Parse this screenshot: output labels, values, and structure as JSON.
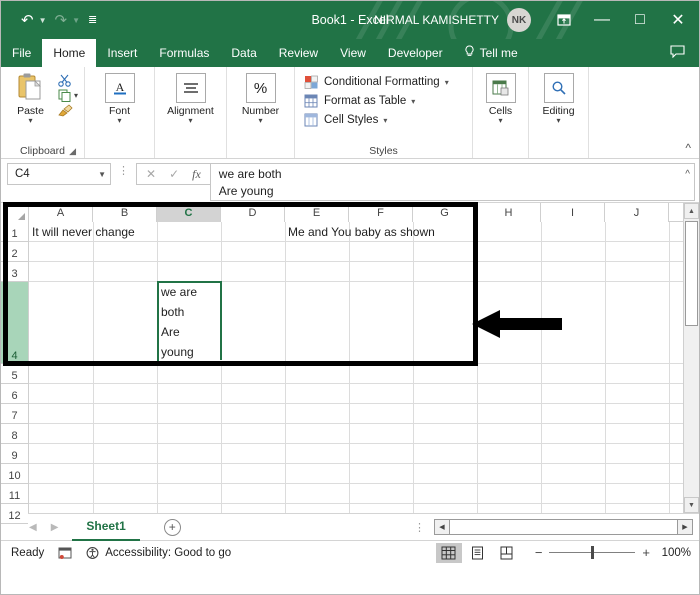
{
  "titlebar": {
    "doc_title": "Book1  -  Excel",
    "user_name": "NIRMAL KAMISHETTY",
    "avatar_initials": "NK",
    "qat": [
      {
        "name": "undo",
        "glyph": "↶"
      },
      {
        "name": "redo",
        "glyph": "↷"
      },
      {
        "name": "customize-quick-access-toolbar",
        "glyph": "☰"
      }
    ],
    "window_buttons": {
      "ribbon_display_options": "⊞",
      "minimize": "—",
      "maximize": "□",
      "close": "✕"
    }
  },
  "tabs": {
    "items": [
      {
        "label": "File",
        "active": false
      },
      {
        "label": "Home",
        "active": true
      },
      {
        "label": "Insert",
        "active": false
      },
      {
        "label": "Formulas",
        "active": false
      },
      {
        "label": "Data",
        "active": false
      },
      {
        "label": "Review",
        "active": false
      },
      {
        "label": "View",
        "active": false
      },
      {
        "label": "Developer",
        "active": false
      }
    ],
    "tell_me": "Tell me",
    "tell_me_icon": "💡",
    "share_icon": "💬"
  },
  "ribbon": {
    "groups": [
      {
        "name": "clipboard",
        "label": "Clipboard",
        "paste_label": "Paste",
        "small_items": [
          {
            "name": "cut",
            "glyph": "✂"
          },
          {
            "name": "copy",
            "glyph": "⧉"
          },
          {
            "name": "format-painter",
            "glyph": "🖌"
          }
        ]
      },
      {
        "name": "font",
        "label": "",
        "button_label": "Font",
        "button_glyph": "A"
      },
      {
        "name": "alignment",
        "label": "",
        "button_label": "Alignment",
        "button_glyph": "≡"
      },
      {
        "name": "number",
        "label": "",
        "button_label": "Number",
        "button_glyph": "%"
      },
      {
        "name": "styles",
        "label": "Styles",
        "rows": [
          {
            "label": "Conditional Formatting",
            "caret": true
          },
          {
            "label": "Format as Table",
            "caret": true
          },
          {
            "label": "Cell Styles",
            "caret": true
          }
        ]
      },
      {
        "name": "cells",
        "label": "",
        "button_label": "Cells",
        "button_glyph": "⊞"
      },
      {
        "name": "editing",
        "label": "",
        "button_label": "Editing",
        "button_glyph": "🔍"
      }
    ],
    "collapse_glyph": "⌃"
  },
  "formula_bar": {
    "name_box_value": "C4",
    "name_box_caret": "▾",
    "cancel_icon": "✕",
    "enter_icon": "✓",
    "function_icon": "fx",
    "content_lines": [
      "we are both",
      "Are young"
    ],
    "expand_icon": "⌃"
  },
  "grid": {
    "columns": [
      "A",
      "B",
      "C",
      "D",
      "E",
      "F",
      "G",
      "H",
      "I",
      "J"
    ],
    "selected_column": "C",
    "rows": [
      "1",
      "2",
      "3",
      "4",
      "5",
      "6",
      "7",
      "8",
      "9",
      "10",
      "11",
      "12"
    ],
    "selected_row": "4",
    "cells": [
      {
        "ref": "A1",
        "value": "It will never change"
      },
      {
        "ref": "E1",
        "value": "Me and You baby as shown"
      }
    ],
    "active_cell": {
      "ref": "C4",
      "wrapped_lines": [
        "we are",
        "both",
        "Are",
        "young"
      ]
    },
    "annotations": [
      {
        "name": "highlight-box",
        "shape": "rectangle",
        "color": "#000000"
      },
      {
        "name": "pointer-arrow",
        "shape": "left-arrow",
        "color": "#000000"
      }
    ]
  },
  "sheet_bar": {
    "nav_prev": "◀",
    "nav_next": "▶",
    "sheets": [
      {
        "label": "Sheet1",
        "active": true
      }
    ],
    "add_sheet_glyph": "+",
    "more_dots": "⋮",
    "hscroll_left": "◀",
    "hscroll_right": "▶"
  },
  "status_bar": {
    "mode": "Ready",
    "macro_icon": "▤",
    "accessibility_icon": "♿",
    "accessibility_text": "Accessibility: Good to go",
    "views": [
      {
        "name": "normal-view",
        "glyph": "⊞",
        "active": true
      },
      {
        "name": "page-layout-view",
        "glyph": "▤",
        "active": false
      },
      {
        "name": "page-break-preview",
        "glyph": "⌹",
        "active": false
      }
    ],
    "zoom_out": "−",
    "zoom_in": "+",
    "zoom_level": "100%"
  }
}
